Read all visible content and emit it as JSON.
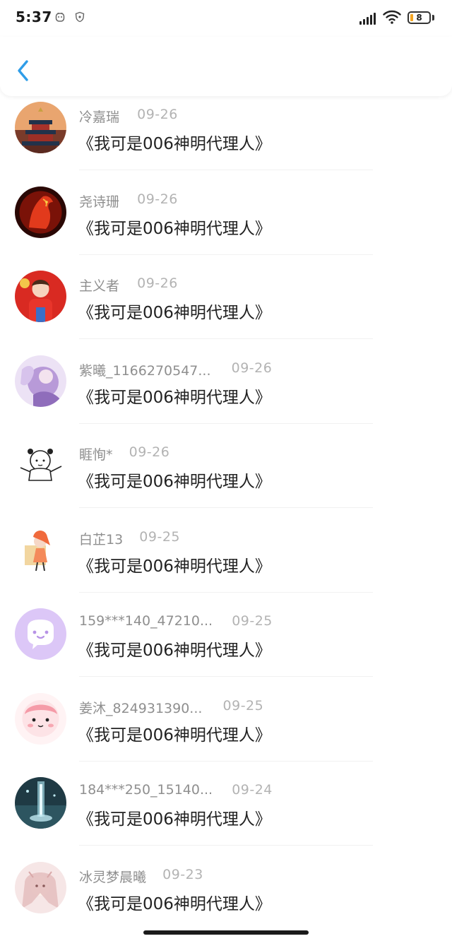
{
  "status_bar": {
    "time": "5:37",
    "battery_level": "8",
    "icons": [
      "notification-face-icon",
      "shield-icon",
      "signal-icon",
      "wifi-icon",
      "battery-icon"
    ]
  },
  "header": {
    "back_icon": "chevron-left-icon"
  },
  "items": [
    {
      "name": "冷嘉瑞",
      "date": "09-26",
      "text": "《我可是006神明代理人》",
      "avatar_colors": [
        "#d48a5b",
        "#8a2f25"
      ]
    },
    {
      "name": "尧诗珊",
      "date": "09-26",
      "text": "《我可是006神明代理人》",
      "avatar_colors": [
        "#c8261a",
        "#3a0a05"
      ]
    },
    {
      "name": "主义者",
      "date": "09-26",
      "text": "《我可是006神明代理人》",
      "avatar_colors": [
        "#e53a2f",
        "#f0c95a"
      ]
    },
    {
      "name": "紫曦_1166270547...",
      "date": "09-26",
      "text": "《我可是006神明代理人》",
      "avatar_colors": [
        "#cdb6e8",
        "#8f6dbb"
      ]
    },
    {
      "name": "睚恂*",
      "date": "09-26",
      "text": "《我可是006神明代理人》",
      "avatar_colors": [
        "#ffffff",
        "#222222"
      ]
    },
    {
      "name": "白芷13",
      "date": "09-25",
      "text": "《我可是006神明代理人》",
      "avatar_colors": [
        "#ffffff",
        "#f06a3c"
      ]
    },
    {
      "name": "159***140_47210...",
      "date": "09-25",
      "text": "《我可是006神明代理人》",
      "avatar_colors": [
        "#d9c3f5",
        "#ffffff"
      ]
    },
    {
      "name": "姜沐_824931390...",
      "date": "09-25",
      "text": "《我可是006神明代理人》",
      "avatar_colors": [
        "#fde3e6",
        "#f59ba8"
      ]
    },
    {
      "name": "184***250_15140...",
      "date": "09-24",
      "text": "《我可是006神明代理人》",
      "avatar_colors": [
        "#1f3a44",
        "#9fd7e3"
      ]
    },
    {
      "name": "冰灵梦晨曦",
      "date": "09-23",
      "text": "《我可是006神明代理人》",
      "avatar_colors": [
        "#f3dcdc",
        "#d9a8a8"
      ]
    }
  ]
}
